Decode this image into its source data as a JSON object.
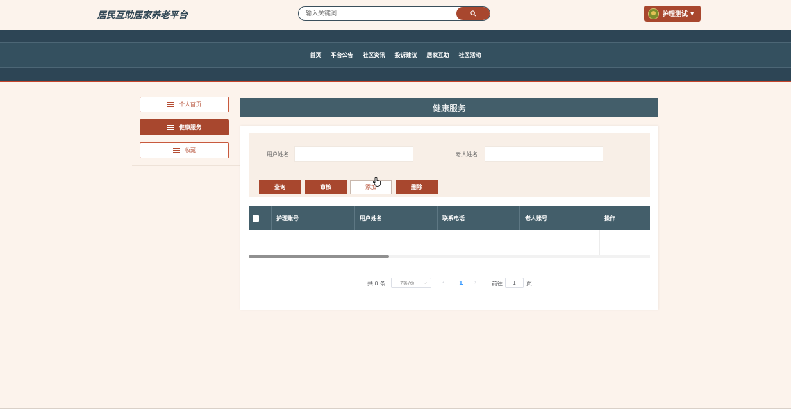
{
  "header": {
    "site_title": "居民互助居家养老平台",
    "search_placeholder": "输入关键词",
    "user_name": "护理测试"
  },
  "nav": {
    "items": [
      "首页",
      "平台公告",
      "社区资讯",
      "投诉建议",
      "居家互助",
      "社区活动"
    ]
  },
  "sidebar": {
    "items": [
      {
        "label": "个人首页",
        "active": false
      },
      {
        "label": "健康服务",
        "active": true
      },
      {
        "label": "收藏",
        "active": false
      }
    ]
  },
  "main": {
    "page_title": "健康服务",
    "filters": {
      "user_name_label": "用户姓名",
      "elder_name_label": "老人姓名"
    },
    "buttons": {
      "query": "查询",
      "review": "审核",
      "add": "添加",
      "delete": "删除"
    },
    "table": {
      "columns": [
        "护理账号",
        "用户姓名",
        "联系电话",
        "老人账号",
        "操作"
      ],
      "rows": []
    },
    "pagination": {
      "total": "共 0 条",
      "page_size": "7条/页",
      "current_page": "1",
      "goto_label": "前往",
      "goto_value": "1",
      "page_suffix": "页"
    }
  },
  "colors": {
    "accent": "#a8472e",
    "nav_bg": "#2b4151",
    "header_bar": "#435e6a",
    "page_bg": "#fcf3ec"
  }
}
